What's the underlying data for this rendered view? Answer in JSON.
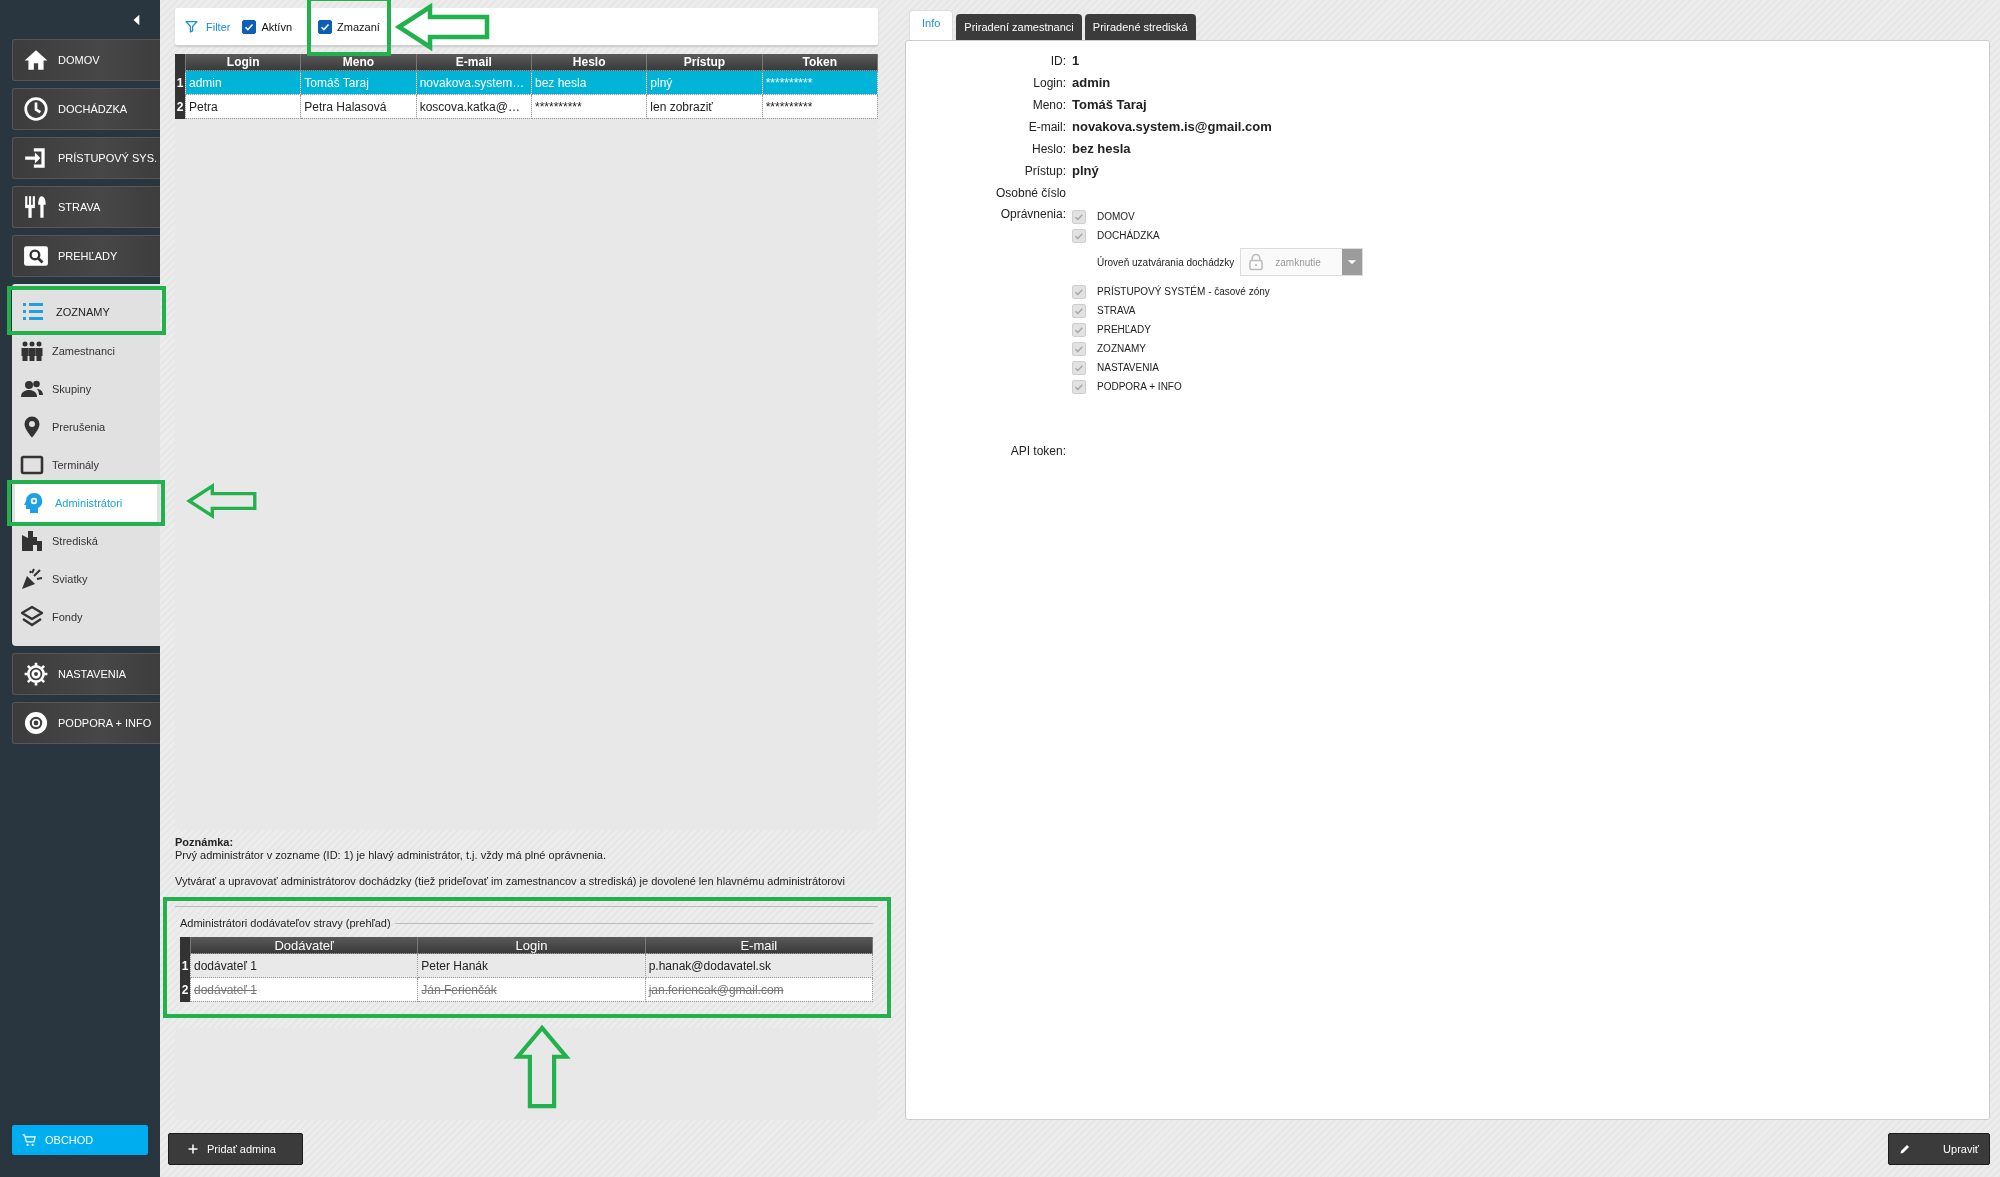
{
  "sidebar": {
    "nav": [
      {
        "kind": "main",
        "label": "DOMOV"
      },
      {
        "kind": "main",
        "label": "DOCHÁDZKA"
      },
      {
        "kind": "main",
        "label": "PRÍSTUPOVÝ SYS."
      },
      {
        "kind": "main",
        "label": "STRAVA"
      },
      {
        "kind": "main",
        "label": "PREHĽADY"
      },
      {
        "kind": "group",
        "label": "ZOZNAMY",
        "expanded": true,
        "children": [
          {
            "label": "Zamestnanci",
            "selected": false
          },
          {
            "label": "Skupiny",
            "selected": false
          },
          {
            "label": "Prerušenia",
            "selected": false
          },
          {
            "label": "Terminály",
            "selected": false
          },
          {
            "label": "Administrátori",
            "selected": true
          },
          {
            "label": "Strediská",
            "selected": false
          },
          {
            "label": "Sviatky",
            "selected": false
          },
          {
            "label": "Fondy",
            "selected": false
          }
        ]
      },
      {
        "kind": "main",
        "label": "NASTAVENIA"
      },
      {
        "kind": "main",
        "label": "PODPORA + INFO"
      }
    ],
    "shop_button": "OBCHOD"
  },
  "filter": {
    "label": "Filter",
    "checkboxes": [
      {
        "label": "Aktívn",
        "checked": true
      },
      {
        "label": "Zmazaní",
        "checked": true
      }
    ]
  },
  "admins_table": {
    "columns": [
      "Login",
      "Meno",
      "E-mail",
      "Heslo",
      "Prístup",
      "Token"
    ],
    "rows": [
      {
        "number": "1",
        "selected": true,
        "cells": [
          "admin",
          "Tomáš Taraj",
          "novakova.system…",
          "bez hesla",
          "plný",
          "**********"
        ]
      },
      {
        "number": "2",
        "selected": false,
        "cells": [
          "Petra",
          "Petra Halasová",
          "koscova.katka@…",
          "**********",
          "len zobraziť",
          "**********"
        ]
      }
    ]
  },
  "note": {
    "title": "Poznámka:",
    "lines": [
      "Prvý administrátor v zozname (ID: 1) je hlavý administrátor, t.j. vždy má plné oprávnenia.",
      "Vytvárať a upravovať administrátorov dochádzky (tiež prideľovať im zamestnancov a strediská) je dovolené len hlavnému administrátorovi"
    ]
  },
  "supplier_admins": {
    "title": "Administrátori dodávateľov stravy (prehľad)",
    "columns": [
      "Dodávateľ",
      "Login",
      "E-mail"
    ],
    "rows": [
      {
        "number": "1",
        "deleted": false,
        "cells": [
          "dodávateľ 1",
          "Peter Hanák",
          "p.hanak@dodavatel.sk"
        ]
      },
      {
        "number": "2",
        "deleted": true,
        "cells": [
          "dodávateľ 1",
          "Ján Ferienčák",
          "jan.feriencak@gmail.com"
        ]
      }
    ]
  },
  "add_button": "Pridať admina",
  "tabs": [
    {
      "label": "Info",
      "selected": true
    },
    {
      "label": "Priradení zamestnanci",
      "selected": false
    },
    {
      "label": "Priradené strediská",
      "selected": false
    }
  ],
  "info": {
    "fields": [
      {
        "label": "ID:",
        "value": "1"
      },
      {
        "label": "Login:",
        "value": "admin"
      },
      {
        "label": "Meno:",
        "value": "Tomáš Taraj"
      },
      {
        "label": "E-mail:",
        "value": "novakova.system.is@gmail.com"
      },
      {
        "label": "Heslo:",
        "value": "bez hesla"
      },
      {
        "label": "Prístup:",
        "value": "plný"
      },
      {
        "label": "Osobné číslo"
      }
    ],
    "permissions_label": "Oprávnenia:",
    "permissions": [
      {
        "kind": "checkbox",
        "label": "DOMOV",
        "checked": true,
        "disabled": true
      },
      {
        "kind": "checkbox",
        "label": "DOCHÁDZKA",
        "checked": true,
        "disabled": true
      },
      {
        "kind": "select",
        "label": "Úroveň uzatvárania dochádzky",
        "value": "zamknutie",
        "disabled": true
      },
      {
        "kind": "checkbox",
        "label": "PRÍSTUPOVÝ SYSTÉM - časové zóny",
        "checked": true,
        "disabled": true
      },
      {
        "kind": "checkbox",
        "label": "STRAVA",
        "checked": true,
        "disabled": true
      },
      {
        "kind": "checkbox",
        "label": "PREHĽADY",
        "checked": true,
        "disabled": true
      },
      {
        "kind": "checkbox",
        "label": "ZOZNAMY",
        "checked": true,
        "disabled": true
      },
      {
        "kind": "checkbox",
        "label": "NASTAVENIA",
        "checked": true,
        "disabled": true
      },
      {
        "kind": "checkbox",
        "label": "PODPORA + INFO",
        "checked": true,
        "disabled": true
      }
    ],
    "api_token_label": "API token:"
  },
  "edit_button": "Upraviť"
}
